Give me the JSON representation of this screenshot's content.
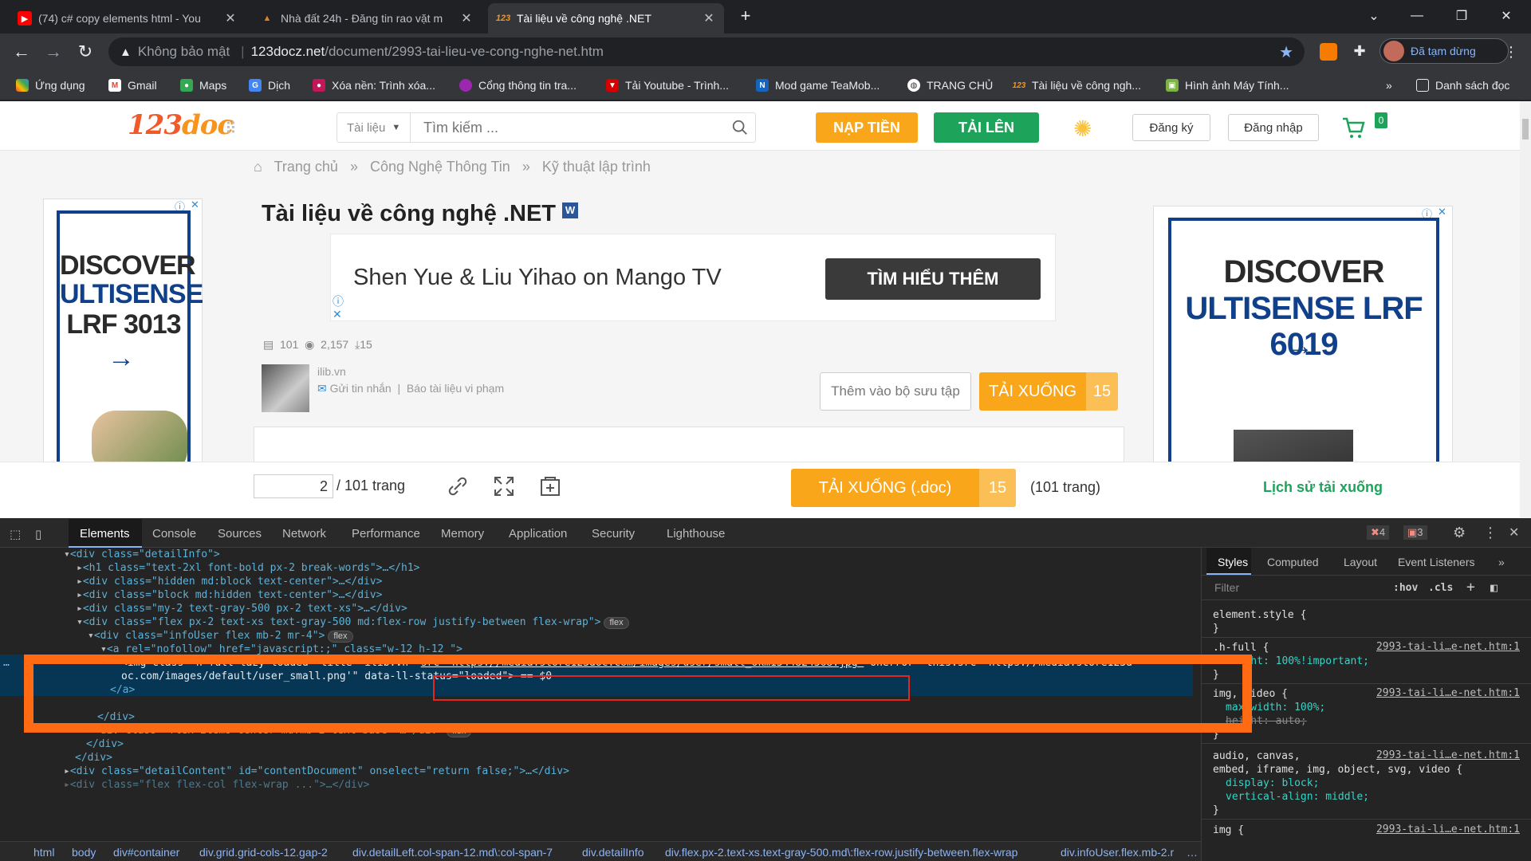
{
  "tabs": [
    {
      "title": "(74) c# copy elements html - You",
      "icon": "youtube-icon"
    },
    {
      "title": "Nhà đất 24h - Đăng tin rao vặt m",
      "icon": "house-icon"
    },
    {
      "title": "Tài liệu về công nghệ .NET",
      "icon": "123doc-icon"
    }
  ],
  "omnibox": {
    "security": "Không bảo mật",
    "host": "123docz.net",
    "path": "/document/2993-tai-lieu-ve-cong-nghe-net.htm"
  },
  "profile": {
    "label": "Đã tạm dừng"
  },
  "bookmarks": [
    "Ứng dụng",
    "Gmail",
    "Maps",
    "Dịch",
    "Xóa nền: Trình xóa...",
    "Cổng thông tin tra...",
    "Tải Youtube - Trình...",
    "Mod game TeaMob...",
    "TRANG CHỦ",
    "Tài liệu về công ngh...",
    "Hình ảnh Máy Tính..."
  ],
  "bookmarks_more": "»",
  "reading_list": "Danh sách đọc",
  "site": {
    "logo_main": "123",
    "logo_doc": "doc",
    "search_category": "Tài liệu",
    "search_placeholder": "Tìm kiếm ...",
    "btn_topup": "NẠP TIỀN",
    "btn_upload": "TẢI LÊN",
    "btn_register": "Đăng ký",
    "btn_login": "Đăng nhập",
    "cart_count": "0",
    "breadcrumb": [
      "Trang chủ",
      "»",
      "Công Nghệ Thông Tin",
      "»",
      "Kỹ thuật lập trình"
    ],
    "title": "Tài liệu về công nghệ .NET",
    "word_badge": "W",
    "banner_text": "Shen Yue & Liu Yihao on Mango TV",
    "banner_cta": "TÌM HIỂU THÊM",
    "ad_left": {
      "l1": "DISCOVER",
      "l2": "ULTISENSE",
      "l3": "LRF 3013"
    },
    "ad_right": {
      "l1": "DISCOVER",
      "l2": "ULTISENSE LRF 6019"
    },
    "stats": {
      "pages": "101",
      "views": "2,157",
      "downloads": "15"
    },
    "uploader": "ilib.vn",
    "send_msg": "Gửi tin nhắn",
    "report": "Báo tài liệu vi phạm",
    "add_collection": "Thêm vào bộ sưu tập",
    "download_label": "TẢI XUỐNG",
    "download_count": "15",
    "page_current": "2",
    "page_total": "/ 101 trang",
    "download_doc_label": "TẢI XUỐNG (.doc)",
    "download_doc_count": "15",
    "pages_note": "(101 trang)",
    "history": "Lịch sử tải xuống"
  },
  "devtools": {
    "tabs": [
      "Elements",
      "Console",
      "Sources",
      "Network",
      "Performance",
      "Memory",
      "Application",
      "Security",
      "Lighthouse"
    ],
    "errors": "4",
    "warnings": "3",
    "style_tabs": [
      "Styles",
      "Computed",
      "Layout",
      "Event Listeners",
      "»"
    ],
    "filter_placeholder": "Filter",
    "hov": ":hov",
    "cls": ".cls",
    "dom_lines": [
      "<div class=\"detailInfo\">",
      "<h1 class=\"text-2xl font-bold px-2 break-words\">…</h1>",
      "<div class=\"hidden md:block text-center\">…</div>",
      "<div class=\"block md:hidden text-center\">…</div>",
      "<div class=\"my-2 text-gray-500 px-2 text-xs\">…</div>",
      "<div class=\"flex  px-2 text-xs text-gray-500  md:flex-row justify-between flex-wrap\">",
      "<div class=\"infoUser flex mb-2 mr-4\">",
      "<a rel=\"nofollow\" href=\"javascript:;\" class=\"w-12 h-12 \">",
      "<img class=\"h-full lazy loaded\" title=\"ilib.vn\" ",
      "src=\"https://media.store123doc.com/images/user/small_okm1344824368.jpg\"",
      " onerror=\"this.src='https://media.store123d",
      "oc.com/images/default/user_small.png'\" data-ll-status=\"loaded\"> == $0",
      "</a>",
      "</div>",
      "<div class=\"flex items-center md:mb-2 text-base\">…</div>",
      "</div>",
      "</div>",
      "<div class=\"detailContent\" id=\"contentDocument\" onselect=\"return false;\">…</div>",
      "<div class=\"flex flex-col flex-wrap ...\">…</div>"
    ],
    "flex_pill": "flex",
    "breadcrumb": [
      "html",
      "body",
      "div#container",
      "div.grid.grid-cols-12.gap-2",
      "div.detailLeft.col-span-12.md\\:col-span-7",
      "div.detailInfo",
      "div.flex.px-2.text-xs.text-gray-500.md\\:flex-row.justify-between.flex-wrap",
      "div.infoUser.flex.mb-2.r",
      "…"
    ],
    "styles": {
      "element_style": "element.style {",
      "close": "}",
      "rule1_sel": ".h-full {",
      "rule1_src": "2993-tai-li…e-net.htm:1",
      "rule1_prop": "height: 100%!important;",
      "rule2_sel": "img, video {",
      "rule2_src": "2993-tai-li…e-net.htm:1",
      "rule2_p1": "max-width: 100%;",
      "rule2_p2": "height: auto;",
      "rule3_sel1": "audio, canvas,",
      "rule3_sel2": "embed, iframe, img, object, svg, video {",
      "rule3_src": "2993-tai-li…e-net.htm:1",
      "rule3_p1": "display: block;",
      "rule3_p2": "vertical-align: middle;",
      "rule4_sel": "img {",
      "rule4_src": "2993-tai-li…e-net.htm:1"
    }
  },
  "colors": {
    "accent_orange": "#ff6a13",
    "src_highlight": "#e0281e",
    "site_orange": "#f9a61b",
    "site_green": "#1ea35a"
  }
}
